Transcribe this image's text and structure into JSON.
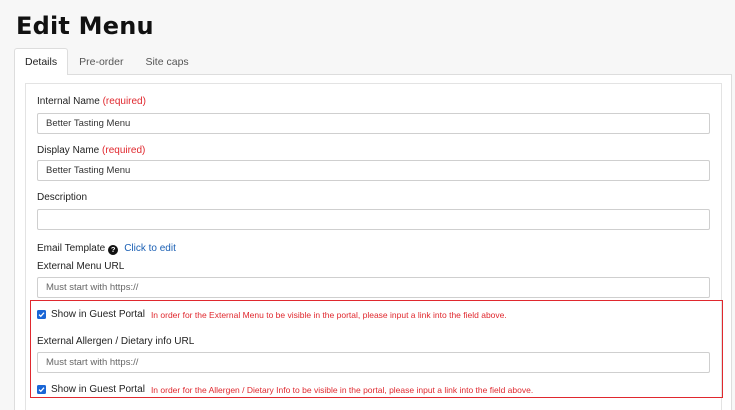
{
  "page": {
    "title": "Edit Menu"
  },
  "tabs": [
    {
      "label": "Details",
      "active": true
    },
    {
      "label": "Pre-order",
      "active": false
    },
    {
      "label": "Site caps",
      "active": false
    }
  ],
  "form": {
    "internal_name": {
      "label": "Internal Name",
      "required": "(required)",
      "value": "Better Tasting Menu"
    },
    "display_name": {
      "label": "Display Name",
      "required": "(required)",
      "value": "Better Tasting Menu"
    },
    "description": {
      "label": "Description",
      "value": ""
    },
    "email_template": {
      "label": "Email Template",
      "help_icon": "question-circle-icon",
      "link": "Click to edit"
    },
    "external_menu_url": {
      "label": "External Menu URL",
      "placeholder": "Must start with https://"
    },
    "guest_portal_1": {
      "checked": true,
      "label": "Show in Guest Portal",
      "warning": "In order for the External Menu to be visible in the portal, please input a link into the field above."
    },
    "allergen_url": {
      "label": "External Allergen / Dietary info URL",
      "placeholder": "Must start with https://"
    },
    "guest_portal_2": {
      "checked": true,
      "label": "Show in Guest Portal",
      "warning": "In order for the Allergen / Dietary Info to be visible in the portal, please input a link into the field above."
    }
  },
  "colors": {
    "required": "#e0282e",
    "link": "#1a5fb4",
    "checkbox": "#1a66d6",
    "warning_border": "#e0282e"
  }
}
